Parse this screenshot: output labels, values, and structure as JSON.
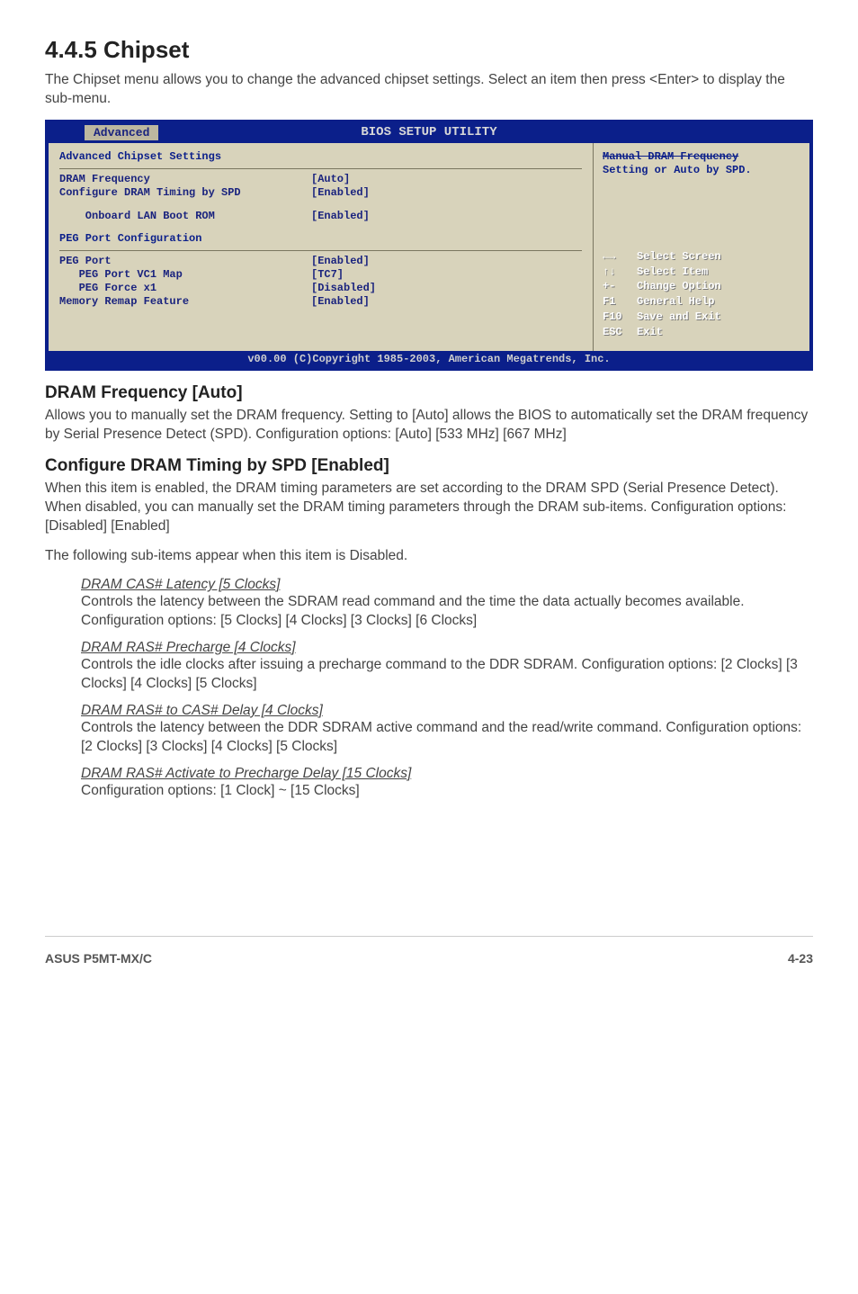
{
  "section": {
    "number_title": "4.4.5  Chipset",
    "intro": "The Chipset menu allows you to change the advanced chipset settings. Select an item then press <Enter> to display the sub-menu."
  },
  "bios": {
    "util_title": "BIOS SETUP UTILITY",
    "tab": "Advanced",
    "panel_heading": "Advanced Chipset Settings",
    "rows_a": [
      {
        "label": "DRAM Frequency",
        "value": "[Auto]"
      },
      {
        "label": "Configure DRAM Timing by SPD",
        "value": "[Enabled]"
      }
    ],
    "rows_b": [
      {
        "label": "    Onboard LAN Boot ROM",
        "value": "[Enabled]"
      }
    ],
    "group_heading": "PEG Port Configuration",
    "rows_c": [
      {
        "label": "PEG Port",
        "value": "[Enabled]"
      },
      {
        "label": "   PEG Port VC1 Map",
        "value": "[TC7]"
      },
      {
        "label": "   PEG Force x1",
        "value": "[Disabled]"
      },
      {
        "label": "Memory Remap Feature",
        "value": "[Enabled]"
      }
    ],
    "help_line1": "Manual DRAM Frequency",
    "help_line2": "Setting or Auto by SPD.",
    "nav": [
      {
        "key": "←→",
        "text": "Select Screen"
      },
      {
        "key": "↑↓",
        "text": "Select Item"
      },
      {
        "key": "+-",
        "text": "Change Option"
      },
      {
        "key": "F1",
        "text": "General Help"
      },
      {
        "key": "F10",
        "text": "Save and Exit"
      },
      {
        "key": "ESC",
        "text": "Exit"
      }
    ],
    "copyright": "v00.00 (C)Copyright 1985-2003, American Megatrends, Inc."
  },
  "fields": [
    {
      "title": "DRAM Frequency [Auto]",
      "desc": "Allows you to manually set the DRAM frequency. Setting to [Auto] allows the BIOS to automatically set the DRAM frequency by Serial Presence Detect (SPD). Configuration options: [Auto] [533 MHz] [667 MHz]"
    },
    {
      "title": "Configure DRAM Timing by SPD [Enabled]",
      "desc": "When this item is enabled, the DRAM timing parameters are set according to the DRAM SPD (Serial Presence Detect). When disabled, you can manually set the DRAM timing parameters through the DRAM sub-items. Configuration options: [Disabled] [Enabled]",
      "after": "The following sub-items appear when this item is Disabled."
    }
  ],
  "subitems": [
    {
      "label": "DRAM CAS# Latency [5 Clocks]",
      "desc": "Controls the latency between the SDRAM read command and the time the data actually becomes available.",
      "opts": "Configuration options: [5 Clocks] [4 Clocks] [3 Clocks] [6 Clocks]"
    },
    {
      "label": "DRAM RAS# Precharge [4 Clocks]",
      "desc": "Controls the idle clocks after issuing a precharge command to the DDR SDRAM. Configuration options: [2 Clocks] [3 Clocks] [4 Clocks] [5 Clocks]",
      "opts": ""
    },
    {
      "label": "DRAM RAS# to CAS# Delay [4 Clocks]",
      "desc": "Controls the latency between the DDR SDRAM active command and the read/write command. Configuration options: [2 Clocks] [3 Clocks] [4 Clocks] [5 Clocks]",
      "opts": ""
    },
    {
      "label": "DRAM RAS# Activate to Precharge Delay [15 Clocks]",
      "desc": "Configuration options: [1 Clock] ~ [15 Clocks]",
      "opts": ""
    }
  ],
  "footer": {
    "left": "ASUS P5MT-MX/C",
    "right": "4-23"
  }
}
